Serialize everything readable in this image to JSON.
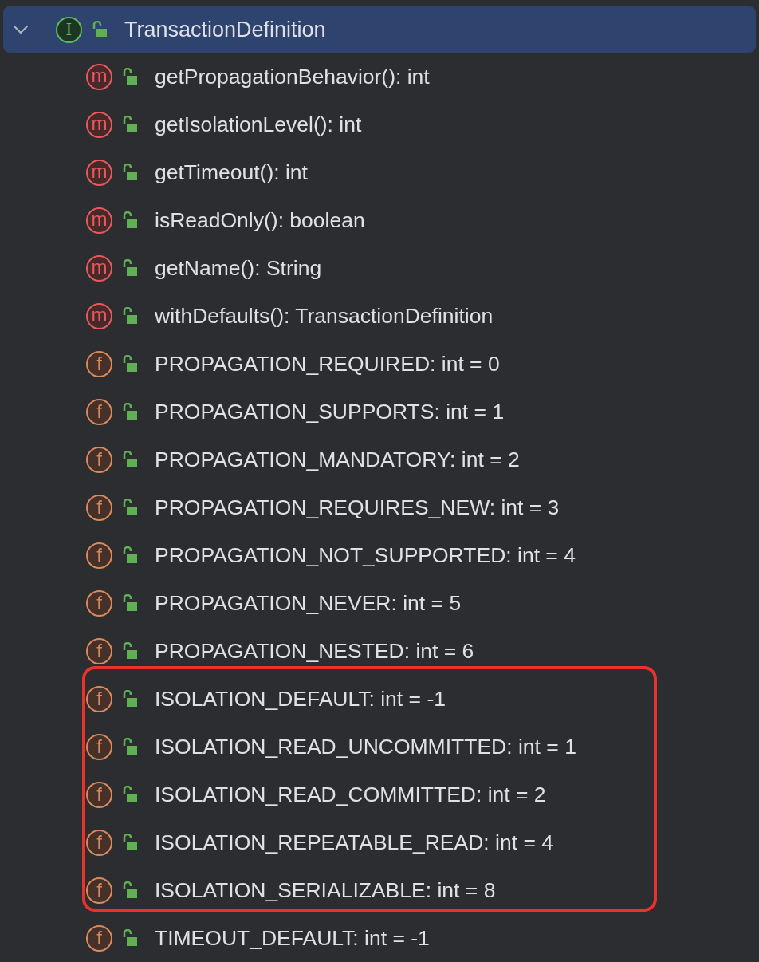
{
  "tree": {
    "label": "TransactionDefinition",
    "kind": "interface",
    "badge": "I",
    "expanded": true,
    "selected": true,
    "children": [
      {
        "label": "getPropagationBehavior(): int",
        "kind": "method",
        "badge": "m",
        "highlighted": false
      },
      {
        "label": "getIsolationLevel(): int",
        "kind": "method",
        "badge": "m",
        "highlighted": false
      },
      {
        "label": "getTimeout(): int",
        "kind": "method",
        "badge": "m",
        "highlighted": false
      },
      {
        "label": "isReadOnly(): boolean",
        "kind": "method",
        "badge": "m",
        "highlighted": false
      },
      {
        "label": "getName(): String",
        "kind": "method",
        "badge": "m",
        "highlighted": false
      },
      {
        "label": "withDefaults(): TransactionDefinition",
        "kind": "method",
        "badge": "m",
        "highlighted": false
      },
      {
        "label": "PROPAGATION_REQUIRED: int = 0",
        "kind": "field",
        "badge": "f",
        "highlighted": false
      },
      {
        "label": "PROPAGATION_SUPPORTS: int = 1",
        "kind": "field",
        "badge": "f",
        "highlighted": false
      },
      {
        "label": "PROPAGATION_MANDATORY: int = 2",
        "kind": "field",
        "badge": "f",
        "highlighted": false
      },
      {
        "label": "PROPAGATION_REQUIRES_NEW: int = 3",
        "kind": "field",
        "badge": "f",
        "highlighted": false
      },
      {
        "label": "PROPAGATION_NOT_SUPPORTED: int = 4",
        "kind": "field",
        "badge": "f",
        "highlighted": false
      },
      {
        "label": "PROPAGATION_NEVER: int = 5",
        "kind": "field",
        "badge": "f",
        "highlighted": false
      },
      {
        "label": "PROPAGATION_NESTED: int = 6",
        "kind": "field",
        "badge": "f",
        "highlighted": false
      },
      {
        "label": "ISOLATION_DEFAULT: int = -1",
        "kind": "field",
        "badge": "f",
        "highlighted": true
      },
      {
        "label": "ISOLATION_READ_UNCOMMITTED: int = 1",
        "kind": "field",
        "badge": "f",
        "highlighted": true
      },
      {
        "label": "ISOLATION_READ_COMMITTED: int = 2",
        "kind": "field",
        "badge": "f",
        "highlighted": true
      },
      {
        "label": "ISOLATION_REPEATABLE_READ: int = 4",
        "kind": "field",
        "badge": "f",
        "highlighted": true
      },
      {
        "label": "ISOLATION_SERIALIZABLE: int = 8",
        "kind": "field",
        "badge": "f",
        "highlighted": true
      },
      {
        "label": "TIMEOUT_DEFAULT: int = -1",
        "kind": "field",
        "badge": "f",
        "highlighted": false
      }
    ]
  }
}
